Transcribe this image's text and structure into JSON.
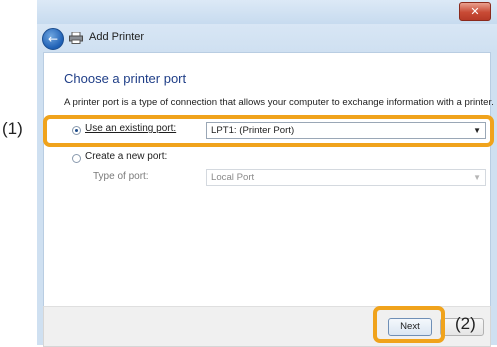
{
  "window": {
    "close_label": "✕"
  },
  "nav": {
    "title": "Add Printer"
  },
  "content": {
    "heading": "Choose a printer port",
    "description": "A printer port is a type of connection that allows your computer to exchange information with a printer.",
    "options": {
      "existing_port": {
        "label": "Use an existing port:",
        "selected": true,
        "value": "LPT1: (Printer Port)"
      },
      "new_port": {
        "label": "Create a new port:",
        "selected": false,
        "type_label": "Type of port:",
        "type_value": "Local Port"
      }
    }
  },
  "footer": {
    "next_label": "Next"
  },
  "annotations": {
    "callout_1": "(1)",
    "callout_2": "(2)",
    "color": "#f0a31c"
  }
}
